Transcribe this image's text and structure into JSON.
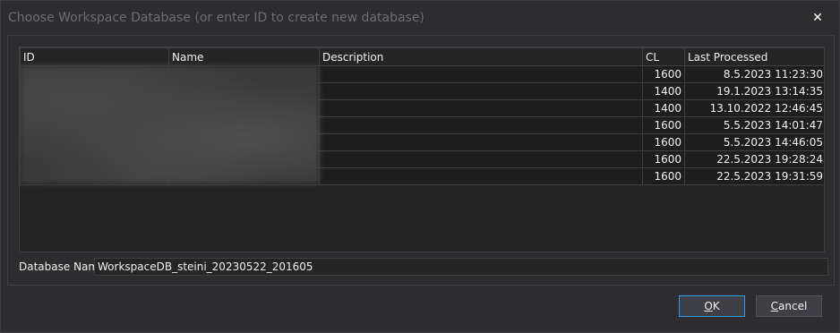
{
  "dialog": {
    "title": "Choose Workspace Database (or enter ID to create new database)",
    "close_glyph": "✕"
  },
  "grid": {
    "columns": [
      "ID",
      "Name",
      "Description",
      "CL",
      "Last Processed"
    ],
    "rows": [
      {
        "id": "",
        "name": "",
        "description": "",
        "cl": "1600",
        "last_processed": "8.5.2023 11:23:30"
      },
      {
        "id": "",
        "name": "",
        "description": "",
        "cl": "1400",
        "last_processed": "19.1.2023 13:14:35"
      },
      {
        "id": "",
        "name": "",
        "description": "",
        "cl": "1400",
        "last_processed": "13.10.2022 12:46:45"
      },
      {
        "id": "",
        "name": "",
        "description": "",
        "cl": "1600",
        "last_processed": "5.5.2023 14:01:47"
      },
      {
        "id": "",
        "name": "",
        "description": "",
        "cl": "1600",
        "last_processed": "5.5.2023 14:46:05"
      },
      {
        "id": "",
        "name": "",
        "description": "",
        "cl": "1600",
        "last_processed": "22.5.2023 19:28:24"
      },
      {
        "id": "",
        "name": "",
        "description": "",
        "cl": "1600",
        "last_processed": "22.5.2023 19:31:59"
      }
    ]
  },
  "database_name": {
    "label": "Database Name",
    "value": "WorkspaceDB_steini_20230522_201605"
  },
  "buttons": {
    "ok_mnemonic": "O",
    "ok_rest": "K",
    "cancel_mnemonic": "C",
    "cancel_rest": "ancel"
  },
  "colors": {
    "background": "#2d2d30",
    "border": "#3f3f46",
    "cell": "#1e1e1e",
    "accent": "#3399ff"
  }
}
